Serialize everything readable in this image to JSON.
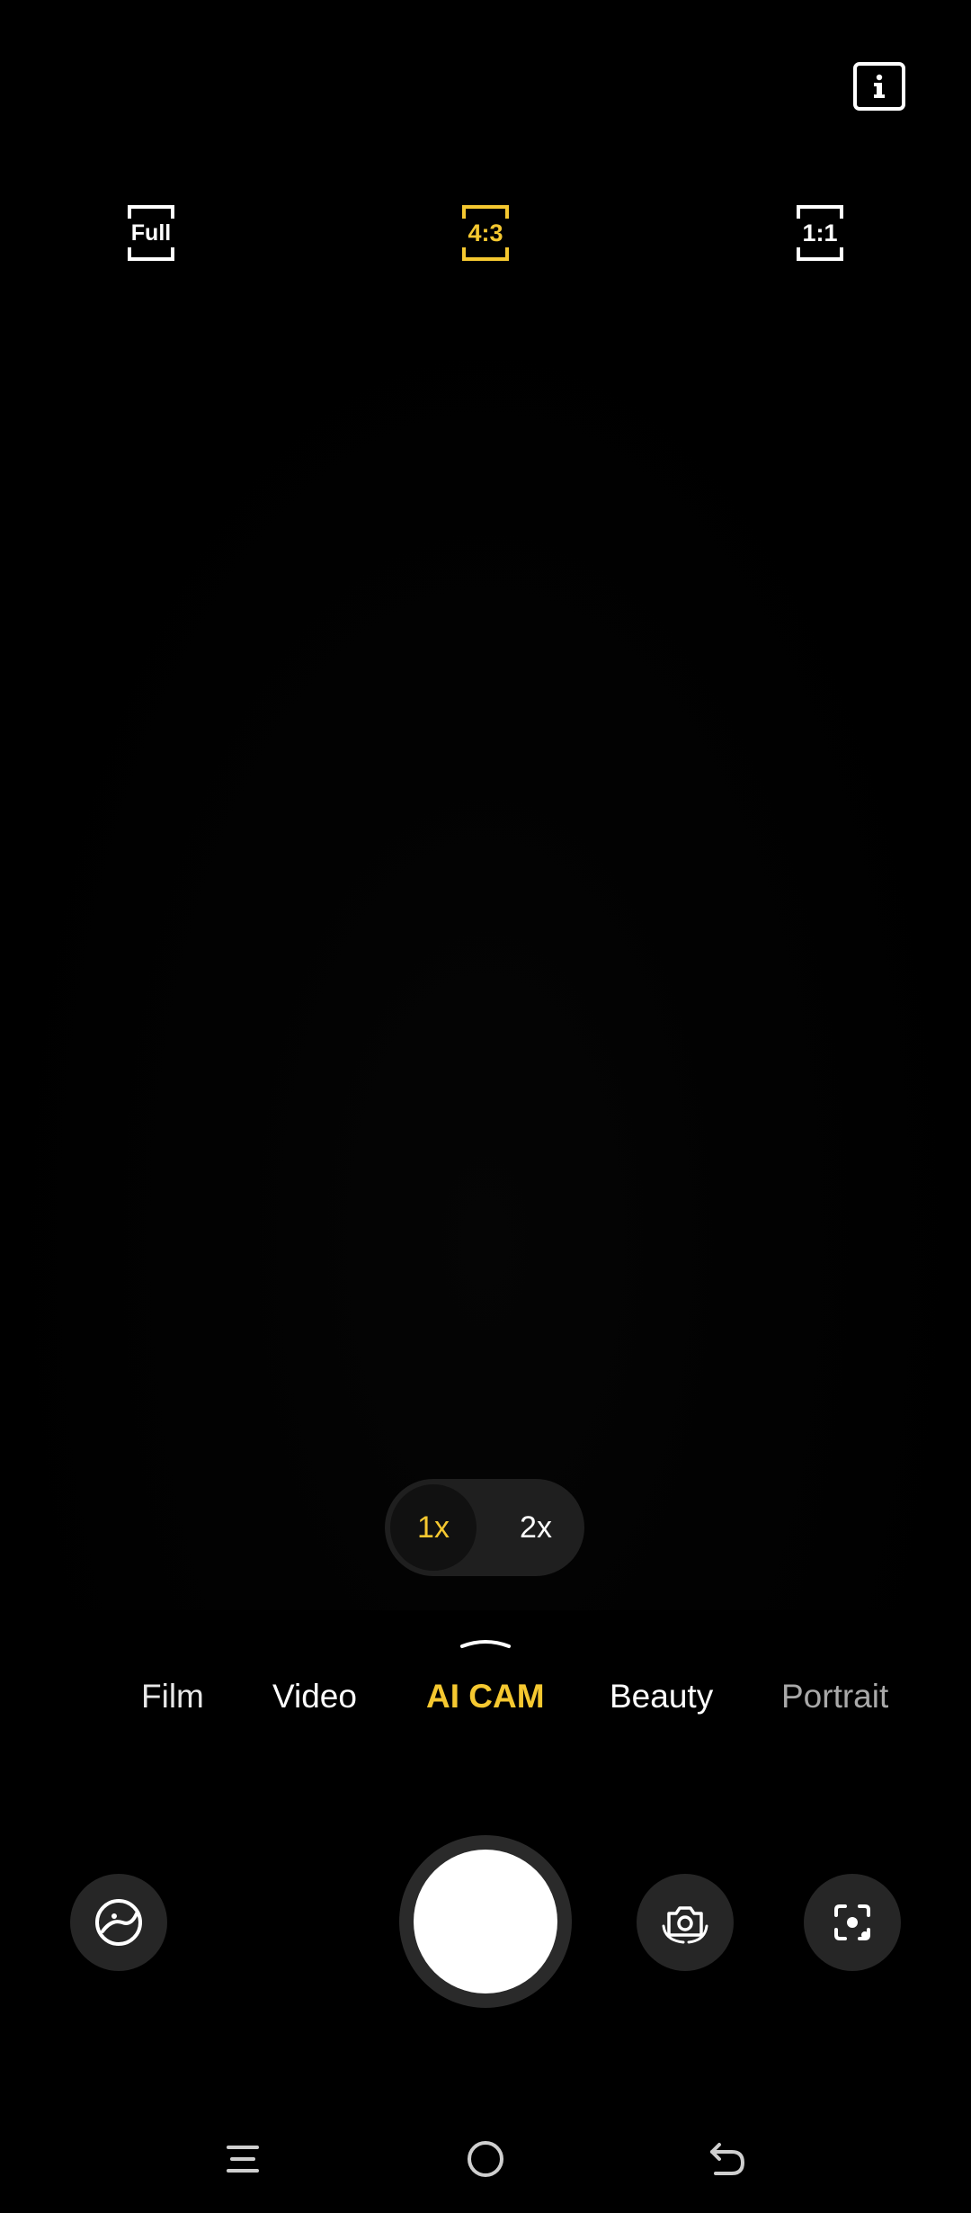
{
  "top_bar": {
    "info_icon": "info-icon"
  },
  "aspect_ratios": {
    "full": "Full",
    "four_three": "4:3",
    "one_one": "1:1",
    "selected": "4:3"
  },
  "zoom": {
    "options": [
      "1x",
      "2x"
    ],
    "selected": "1x"
  },
  "modes": {
    "items": [
      "Film",
      "Video",
      "AI CAM",
      "Beauty",
      "Portrait"
    ],
    "selected": "AI CAM"
  },
  "controls": {
    "filter_icon": "filter-icon",
    "shutter": "shutter-button",
    "flip_icon": "switch-camera-icon",
    "lens_icon": "google-lens-icon"
  },
  "nav": {
    "menu_icon": "menu-icon",
    "home_icon": "home-icon",
    "back_icon": "back-icon"
  },
  "colors": {
    "background": "#000000",
    "accent": "#f5c830",
    "button_bg": "#262626"
  }
}
